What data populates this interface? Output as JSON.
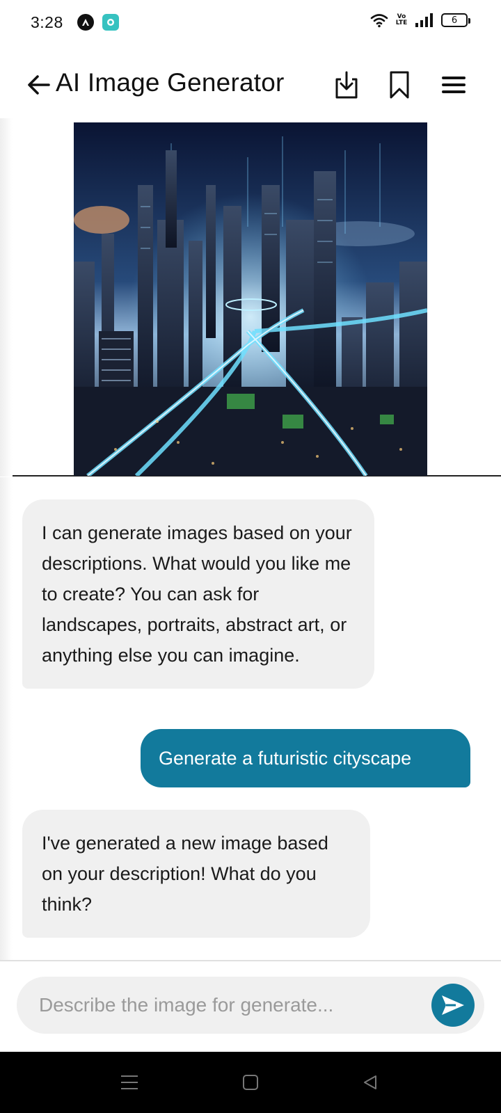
{
  "status_bar": {
    "time": "3:28",
    "network_label": "Vo LTE",
    "battery_level": "6"
  },
  "app_bar": {
    "title": "AI Image Generator",
    "icons": [
      "back-arrow-icon",
      "download-icon",
      "bookmark-icon",
      "menu-icon"
    ]
  },
  "image": {
    "alt": "Futuristic cityscape at night with glowing skyscrapers and light trails"
  },
  "chat": {
    "messages": [
      {
        "role": "assistant",
        "text": "I can generate images based on your descriptions. What would you like me to create? You can ask for landscapes, portraits, abstract art, or anything else you can imagine."
      },
      {
        "role": "user",
        "text": "Generate a futuristic cityscape"
      },
      {
        "role": "assistant",
        "text": "I've generated a new image based on your description! What do you think?"
      }
    ]
  },
  "input": {
    "placeholder": "Describe the image for generate...",
    "value": ""
  },
  "colors": {
    "accent": "#127a9c",
    "ai_bubble": "#f0f0f0",
    "text": "#111111"
  }
}
